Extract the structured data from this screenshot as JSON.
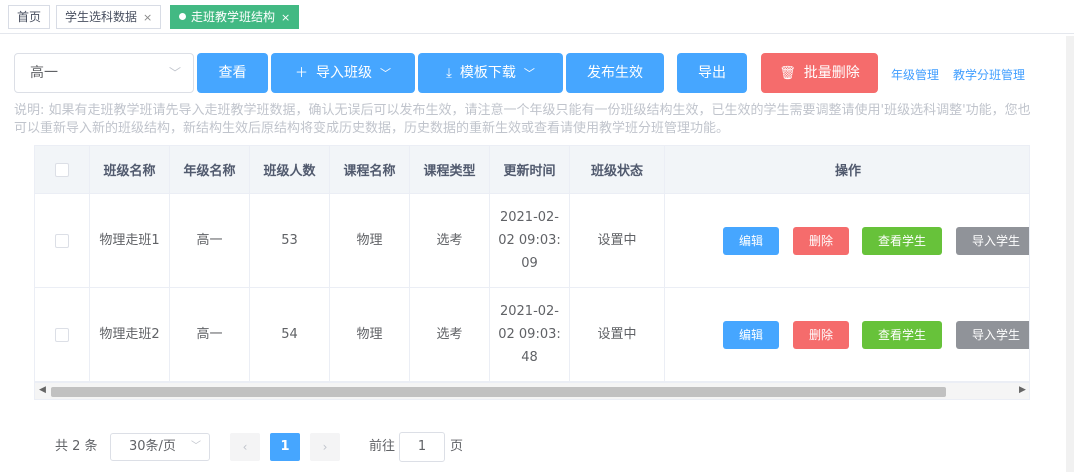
{
  "tabs": [
    {
      "label": "首页",
      "closable": false
    },
    {
      "label": "学生选科数据",
      "closable": true
    },
    {
      "label": "走班教学班结构",
      "closable": true,
      "active": true
    }
  ],
  "close_glyph": "×",
  "toolbar": {
    "grade_select": "高一",
    "view_label": "查看",
    "import_label": "导入班级",
    "template_label": "模板下载",
    "publish_label": "发布生效",
    "export_label": "导出",
    "batch_delete_label": "批量删除",
    "grade_manage_link": "年级管理",
    "class_manage_link": "教学分班管理"
  },
  "note": "说明: 如果有走班教学班请先导入走班教学班数据，确认无误后可以发布生效，请注意一个年级只能有一份班级结构生效，已生效的学生需要调整请使用'班级选科调整'功能，您也可以重新导入新的班级结构，新结构生效后原结构将变成历史数据，历史数据的重新生效或查看请使用教学班分班管理功能。",
  "table": {
    "headers": [
      "班级名称",
      "年级名称",
      "班级人数",
      "课程名称",
      "课程类型",
      "更新时间",
      "班级状态",
      "操作"
    ],
    "rows": [
      {
        "name": "物理走班1",
        "grade": "高一",
        "count": "53",
        "course": "物理",
        "type": "选考",
        "updated": "2021-02-02 09:03:09",
        "status": "设置中"
      },
      {
        "name": "物理走班2",
        "grade": "高一",
        "count": "54",
        "course": "物理",
        "type": "选考",
        "updated": "2021-02-02 09:03:48",
        "status": "设置中"
      }
    ],
    "actions": {
      "edit": "编辑",
      "delete": "删除",
      "view_students": "查看学生",
      "import_students": "导入学生"
    }
  },
  "pagination": {
    "total_text": "共 2 条",
    "page_size": "30条/页",
    "current_page": "1",
    "goto_prefix": "前往",
    "goto_value": "1",
    "goto_suffix": "页"
  },
  "colors": {
    "primary": "#46a6ff",
    "danger": "#f56c6c",
    "success": "#67c23a",
    "info": "#909399",
    "tab_active": "#42b983"
  }
}
